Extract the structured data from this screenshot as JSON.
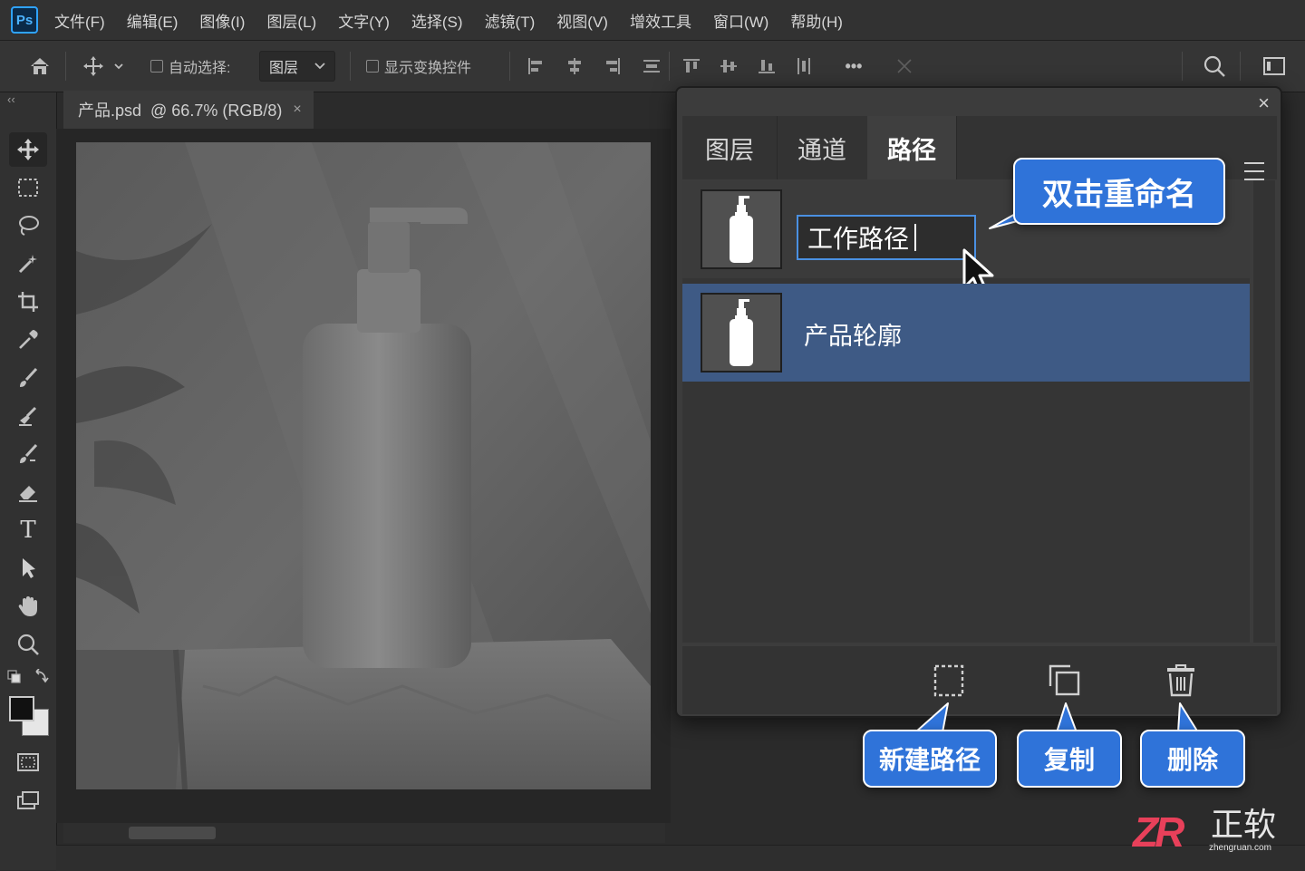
{
  "app": {
    "logo": "Ps"
  },
  "menu": [
    "文件(F)",
    "编辑(E)",
    "图像(I)",
    "图层(L)",
    "文字(Y)",
    "选择(S)",
    "滤镜(T)",
    "视图(V)",
    "增效工具",
    "窗口(W)",
    "帮助(H)"
  ],
  "options": {
    "auto_select_label": "自动选择:",
    "layer_select_value": "图层",
    "show_transform_label": "显示变换控件",
    "more_label": "•••"
  },
  "toolbar": {
    "collapse_label": "‹‹",
    "text_tool_glyph": "T"
  },
  "document": {
    "tab_title": "产品.psd  @ 66.7% (RGB/8)",
    "close_glyph": "×"
  },
  "panel": {
    "close_glyph": "×",
    "tabs": [
      "图层",
      "通道",
      "路径"
    ],
    "active_tab": "路径",
    "paths": [
      {
        "name": "工作路径",
        "editing": true
      },
      {
        "name": "产品轮廓",
        "selected": true
      }
    ],
    "footer_buttons": [
      "new-path",
      "duplicate",
      "delete"
    ]
  },
  "callouts": {
    "rename": "双击重命名",
    "new_path": "新建路径",
    "duplicate": "复制",
    "delete": "删除"
  },
  "watermark": {
    "logo": "ZR",
    "name": "正软",
    "url": "zhengruan.com"
  },
  "colors": {
    "accent": "#2f73d9",
    "selection": "#3e5a85",
    "ps_blue": "#2fa3ff"
  }
}
